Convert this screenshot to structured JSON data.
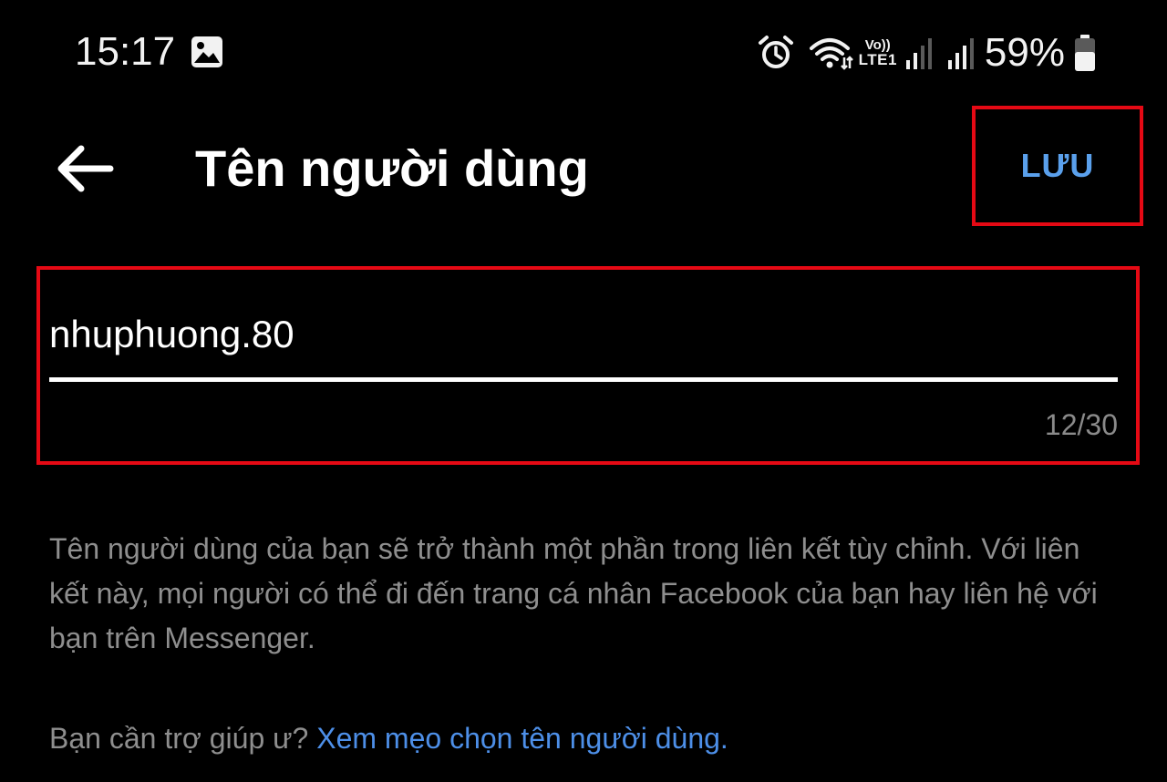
{
  "status_bar": {
    "time": "15:17",
    "network_label_top": "Vo))",
    "network_label_bottom": "LTE1",
    "battery_percent": "59%",
    "icons": [
      "gallery-icon",
      "alarm-icon",
      "wifi-icon",
      "signal-icon",
      "signal-icon",
      "battery-icon"
    ]
  },
  "app_bar": {
    "back_icon": "arrow-left-icon",
    "title": "Tên người dùng",
    "save_label": "LƯU"
  },
  "username_field": {
    "value": "nhuphuong.80",
    "counter": "12/30"
  },
  "help": {
    "description": "Tên người dùng của bạn sẽ trở thành một phần trong liên kết tùy chỉnh. Với liên kết này, mọi người có thể đi đến trang cá nhân Facebook của bạn hay liên hệ với bạn trên Messenger.",
    "tip_prefix": "Bạn cần trợ giúp ư?",
    "tip_link": "Xem mẹo chọn tên người dùng."
  },
  "colors": {
    "background": "#000000",
    "accent_link": "#4d8fe8",
    "save_text": "#5aa0ec",
    "highlight_border": "#e50914",
    "secondary_text": "#8e8e8e"
  }
}
